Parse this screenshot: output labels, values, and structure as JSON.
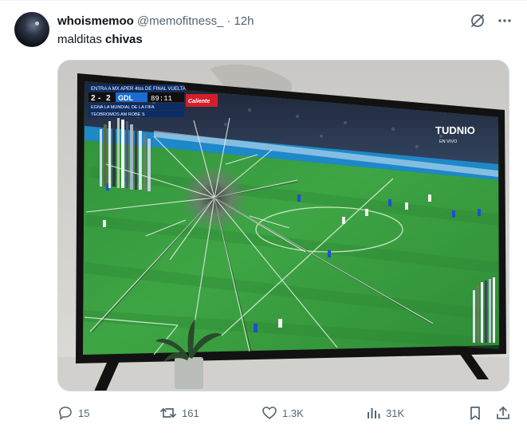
{
  "author": {
    "display_name": "whoismemoo",
    "handle": "@memofitness_",
    "separator": "·",
    "time": "12h"
  },
  "tweet": {
    "text_plain": "malditas",
    "text_bold": "chivas"
  },
  "media": {
    "description_icon": "tv-photo",
    "scorebug": {
      "line1": "ENTRA A MX APER 4tos DE FINAL VUELTA",
      "home": "2",
      "away": "2",
      "team": "GDL",
      "clock": "89:11",
      "sponsor": "Caliente",
      "line2": "EGNA LA MUNDIAL DE LA FIFA",
      "line3": "TEOBROMOS AM ROBE S"
    },
    "broadcaster": "TUDNIO",
    "broadcaster_sub": "EN VIVO"
  },
  "actions": {
    "replies": "15",
    "retweets": "161",
    "likes": "1.3K",
    "views": "31K"
  },
  "icons": [
    "grok-icon",
    "more-icon",
    "reply-icon",
    "retweet-icon",
    "like-icon",
    "views-icon",
    "bookmark-icon",
    "share-icon"
  ],
  "colors": {
    "text": "#0f1419",
    "muted": "#536471",
    "border": "#cfd9de"
  }
}
